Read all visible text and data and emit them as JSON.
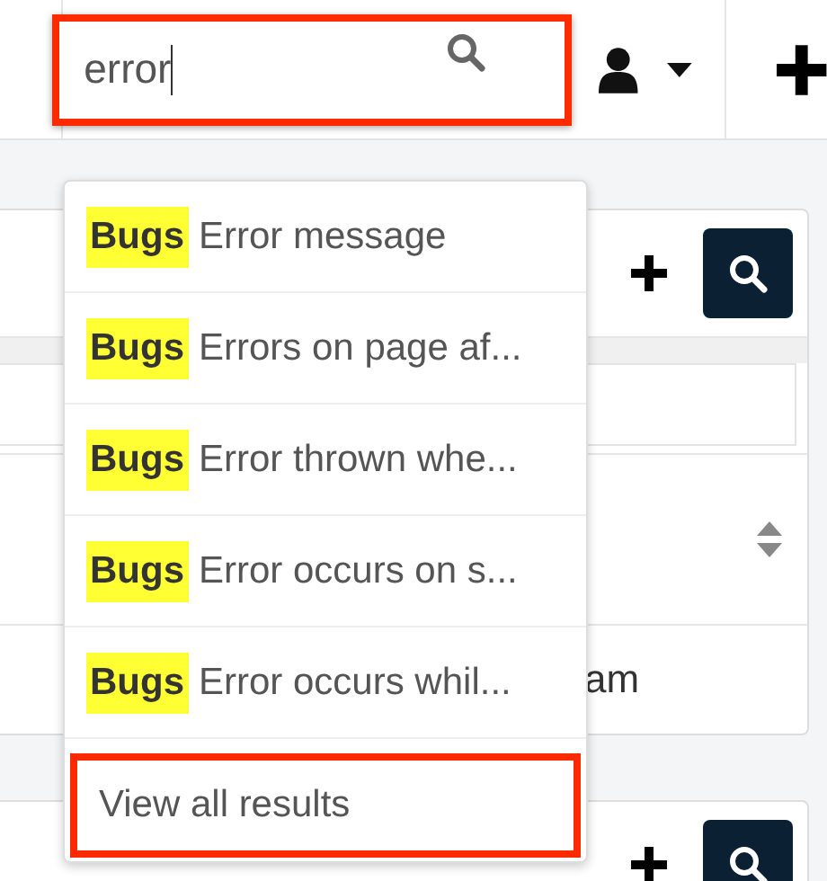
{
  "search": {
    "value": "error",
    "annotated": true
  },
  "results": [
    {
      "module": "Bugs",
      "title": "Error message"
    },
    {
      "module": "Bugs",
      "title": "Errors on page af..."
    },
    {
      "module": "Bugs",
      "title": "Error thrown whe..."
    },
    {
      "module": "Bugs",
      "title": "Error occurs on s..."
    },
    {
      "module": "Bugs",
      "title": "Error occurs whil..."
    }
  ],
  "view_all": {
    "label": "View all results",
    "annotated": true
  },
  "background_panel": {
    "cell_text": "am"
  }
}
